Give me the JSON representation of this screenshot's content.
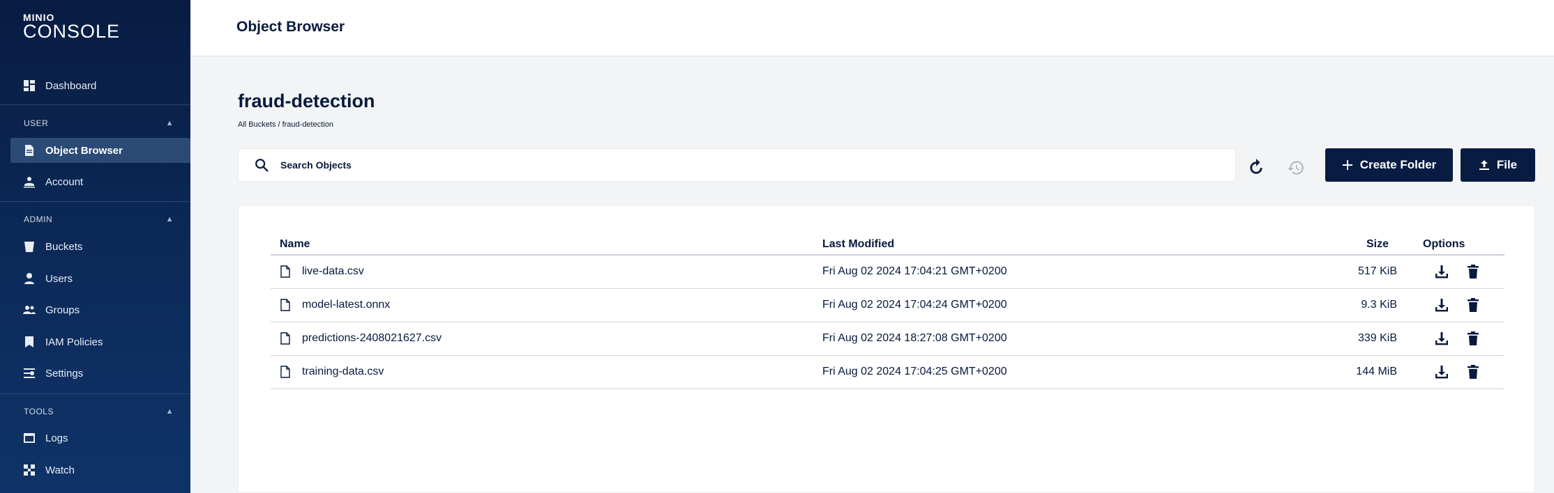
{
  "app": {
    "logo_small": "MINIO",
    "logo_big": "CONSOLE"
  },
  "sidebar": {
    "dashboard": "Dashboard",
    "sections": [
      {
        "title": "USER",
        "items": [
          "Object Browser",
          "Account"
        ]
      },
      {
        "title": "ADMIN",
        "items": [
          "Buckets",
          "Users",
          "Groups",
          "IAM Policies",
          "Settings"
        ]
      },
      {
        "title": "TOOLS",
        "items": [
          "Logs",
          "Watch"
        ]
      }
    ],
    "active": "Object Browser"
  },
  "header": {
    "title": "Object Browser"
  },
  "bucket": {
    "name": "fraud-detection",
    "breadcrumb": "All Buckets / fraud-detection"
  },
  "search": {
    "placeholder": "Search Objects",
    "value": ""
  },
  "actions": {
    "create_folder": "Create Folder",
    "upload_file": "File"
  },
  "table": {
    "columns": {
      "name": "Name",
      "modified": "Last Modified",
      "size": "Size",
      "options": "Options"
    },
    "rows": [
      {
        "name": "live-data.csv",
        "modified": "Fri Aug 02 2024 17:04:21 GMT+0200",
        "size": "517 KiB"
      },
      {
        "name": "model-latest.onnx",
        "modified": "Fri Aug 02 2024 17:04:24 GMT+0200",
        "size": "9.3 KiB"
      },
      {
        "name": "predictions-2408021627.csv",
        "modified": "Fri Aug 02 2024 18:27:08 GMT+0200",
        "size": "339 KiB"
      },
      {
        "name": "training-data.csv",
        "modified": "Fri Aug 02 2024 17:04:25 GMT+0200",
        "size": "144 MiB"
      }
    ]
  },
  "colors": {
    "sidebar_bg": "#081c42",
    "primary": "#081c42",
    "active_item": "#2b4a76",
    "page_bg": "#f3f4f5"
  }
}
